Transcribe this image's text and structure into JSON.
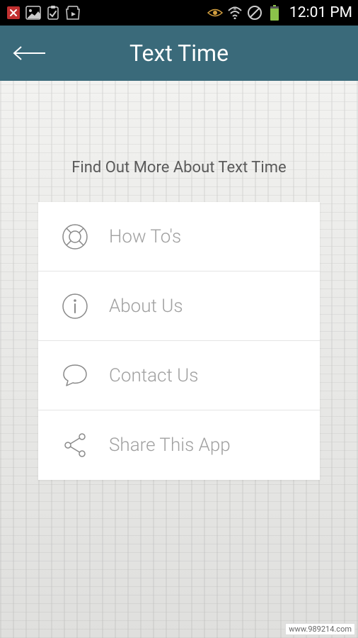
{
  "status_bar": {
    "time": "12:01 PM",
    "notifications": {
      "close": "close-icon",
      "image": "image-icon",
      "clipboard": "clipboard-icon",
      "play": "play-store-icon"
    },
    "system": {
      "eye": "eye-icon",
      "wifi": "wifi-icon",
      "block": "block-icon",
      "battery": "battery-icon"
    }
  },
  "app_bar": {
    "title": "Text Time",
    "back": "back"
  },
  "content": {
    "subtitle": "Find Out More About Text Time"
  },
  "menu": {
    "items": [
      {
        "label": "How To's",
        "icon": "lifebuoy-icon"
      },
      {
        "label": "About Us",
        "icon": "info-icon"
      },
      {
        "label": "Contact Us",
        "icon": "chat-icon"
      },
      {
        "label": "Share This App",
        "icon": "share-icon"
      }
    ]
  },
  "watermark": "www.989214.com",
  "colors": {
    "app_bar_bg": "#3a6a7a",
    "menu_text": "#a0a0a0",
    "icon_stroke": "#8a8a8a"
  }
}
